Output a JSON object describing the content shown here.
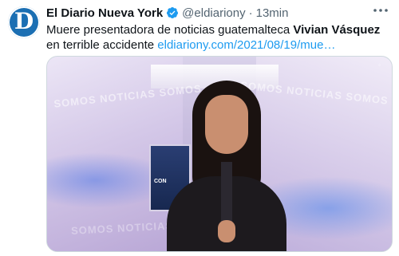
{
  "tweet": {
    "avatar_letter": "D",
    "author_name": "El Diario Nueva York",
    "handle": "@eldiariony",
    "separator": "·",
    "time": "13min",
    "text_before": "Muere presentadora de noticias guatemalteca",
    "text_name": "Vivian Vásquez",
    "text_after": "en terrible accidente",
    "link": "eldiariony.com/2021/08/19/mue…"
  },
  "media": {
    "wall_text": "SOMOS NOTICIAS SOMOS",
    "monitor_text": "CON"
  },
  "colors": {
    "link": "#1d9bf0",
    "verified": "#1d9bf0",
    "avatar_bg": "#1b6fb3"
  },
  "icons": {
    "verified": "verified-badge-icon",
    "more": "more-icon"
  }
}
